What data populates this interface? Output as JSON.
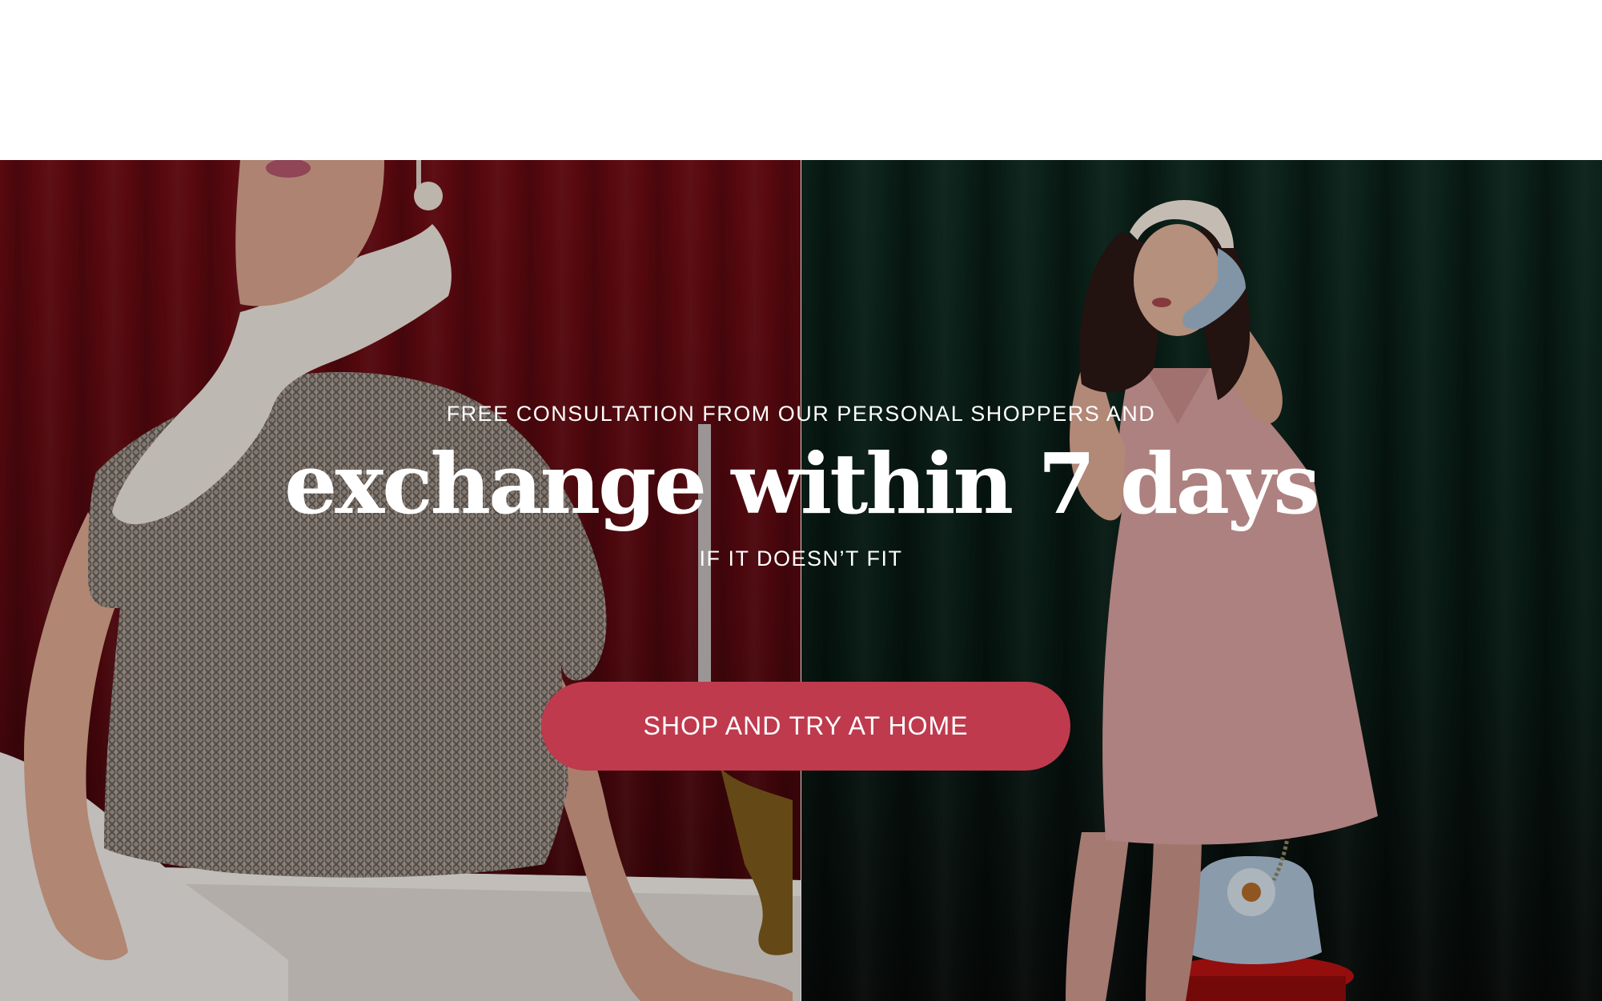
{
  "hero": {
    "eyebrow": "FREE CONSULTATION FROM OUR PERSONAL SHOPPERS AND",
    "headline": "exchange within 7 days",
    "subline": "IF IT DOESN’T FIT",
    "cta_label": "SHOP AND TRY AT HOME",
    "cta_color": "#bf3a4d",
    "left_backdrop_color": "#6e0b13",
    "right_backdrop_color": "#0e2a20"
  }
}
